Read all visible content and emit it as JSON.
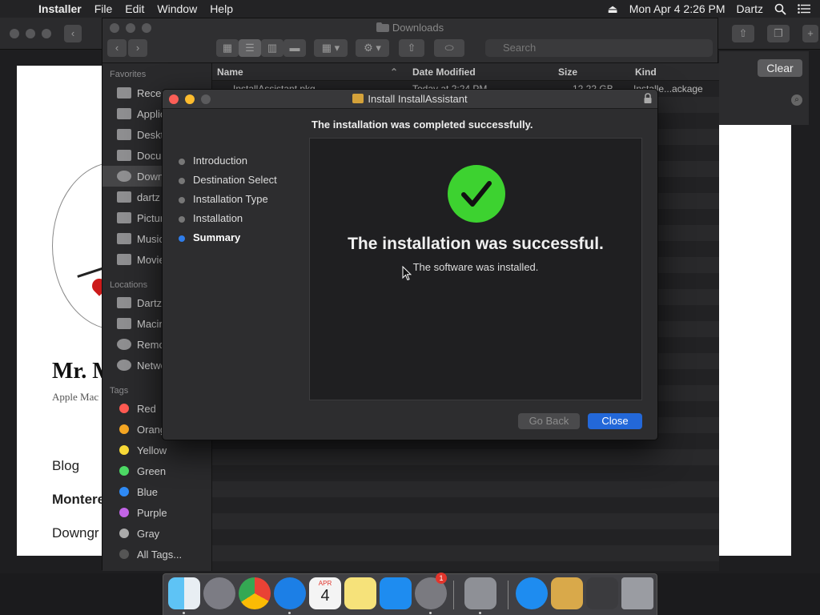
{
  "menubar": {
    "app_name": "Installer",
    "menus": [
      "File",
      "Edit",
      "Window",
      "Help"
    ],
    "datetime": "Mon Apr 4  2:26 PM",
    "user": "Dartz"
  },
  "browser": {
    "clear_button": "Clear",
    "site_name": "Mr. M",
    "site_subtitle": "Apple Mac",
    "nav": [
      "Blog",
      "Montere",
      "Downgr"
    ]
  },
  "finder": {
    "title": "Downloads",
    "search_placeholder": "Search",
    "sidebar": {
      "favorites_heading": "Favorites",
      "favorites": [
        "Recents",
        "Applications",
        "Desktop",
        "Documents",
        "Downloads",
        "dartz",
        "Pictures",
        "Music",
        "Movies"
      ],
      "selected": "Downloads",
      "locations_heading": "Locations",
      "locations": [
        "Dartz",
        "Macintosh",
        "Remote",
        "Network"
      ],
      "tags_heading": "Tags",
      "tags": [
        {
          "label": "Red",
          "color": "#ff5a52"
        },
        {
          "label": "Orange",
          "color": "#f5a623"
        },
        {
          "label": "Yellow",
          "color": "#f8d937"
        },
        {
          "label": "Green",
          "color": "#4cd964"
        },
        {
          "label": "Blue",
          "color": "#2f8af5"
        },
        {
          "label": "Purple",
          "color": "#c264e6"
        },
        {
          "label": "Gray",
          "color": "#aaaaaa"
        },
        {
          "label": "All Tags...",
          "color": "#555555"
        }
      ]
    },
    "columns": [
      "Name",
      "Date Modified",
      "Size",
      "Kind"
    ],
    "rows": [
      {
        "name": "InstallAssistant.pkg",
        "date": "Today at 2:24 PM",
        "size": "12.22 GB",
        "kind": "Installe...ackage"
      }
    ]
  },
  "installer": {
    "title": "Install InstallAssistant",
    "heading": "The installation was completed successfully.",
    "steps": [
      "Introduction",
      "Destination Select",
      "Installation Type",
      "Installation",
      "Summary"
    ],
    "current_step": "Summary",
    "success_title": "The installation was successful.",
    "success_subtitle": "The software was installed.",
    "buttons": {
      "go_back": "Go Back",
      "close": "Close"
    }
  },
  "dock": {
    "apps": [
      "Finder",
      "Launchpad",
      "Chrome",
      "Safari",
      "Calendar",
      "Notes",
      "App Store",
      "System Preferences",
      "Installer",
      "App Store",
      "Package",
      "Keyboard",
      "Trash"
    ],
    "calendar_month": "APR",
    "calendar_day": "4",
    "prefs_badge": "1"
  }
}
